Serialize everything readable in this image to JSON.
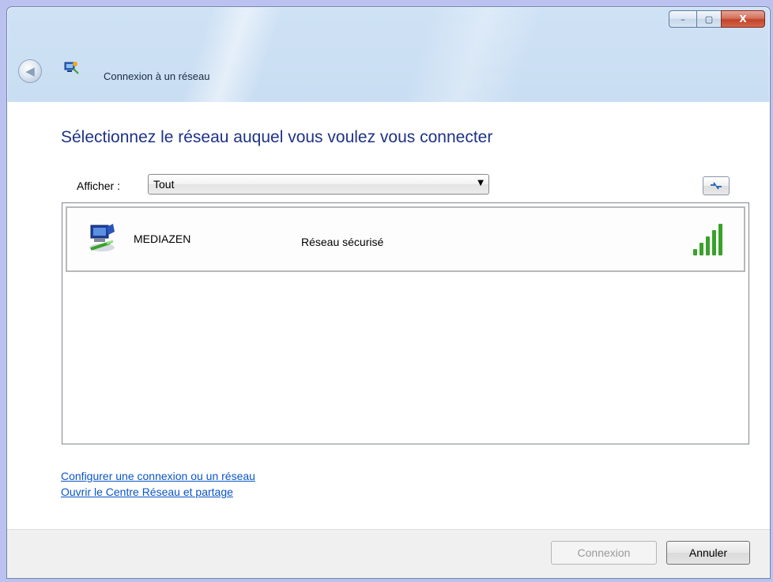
{
  "window": {
    "title": "Connexion à un réseau",
    "controls": {
      "minimize": "–",
      "maximize": "▢",
      "close": "X"
    }
  },
  "main": {
    "heading": "Sélectionnez le réseau auquel vous voulez vous connecter",
    "filter": {
      "label": "Afficher :",
      "selected": "Tout"
    },
    "refresh_icon": "refresh-icon"
  },
  "networks": [
    {
      "name": "MEDIAZEN",
      "security": "Réseau sécurisé",
      "signal_bars": 5,
      "signal_max": 5
    }
  ],
  "links": {
    "setup": "Configurer une connexion ou un réseau",
    "center": "Ouvrir le Centre Réseau et partage"
  },
  "footer": {
    "connect": "Connexion",
    "connect_enabled": false,
    "cancel": "Annuler"
  },
  "colors": {
    "heading": "#1e3287",
    "link": "#0a54c8",
    "signal": "#3aa12b"
  }
}
